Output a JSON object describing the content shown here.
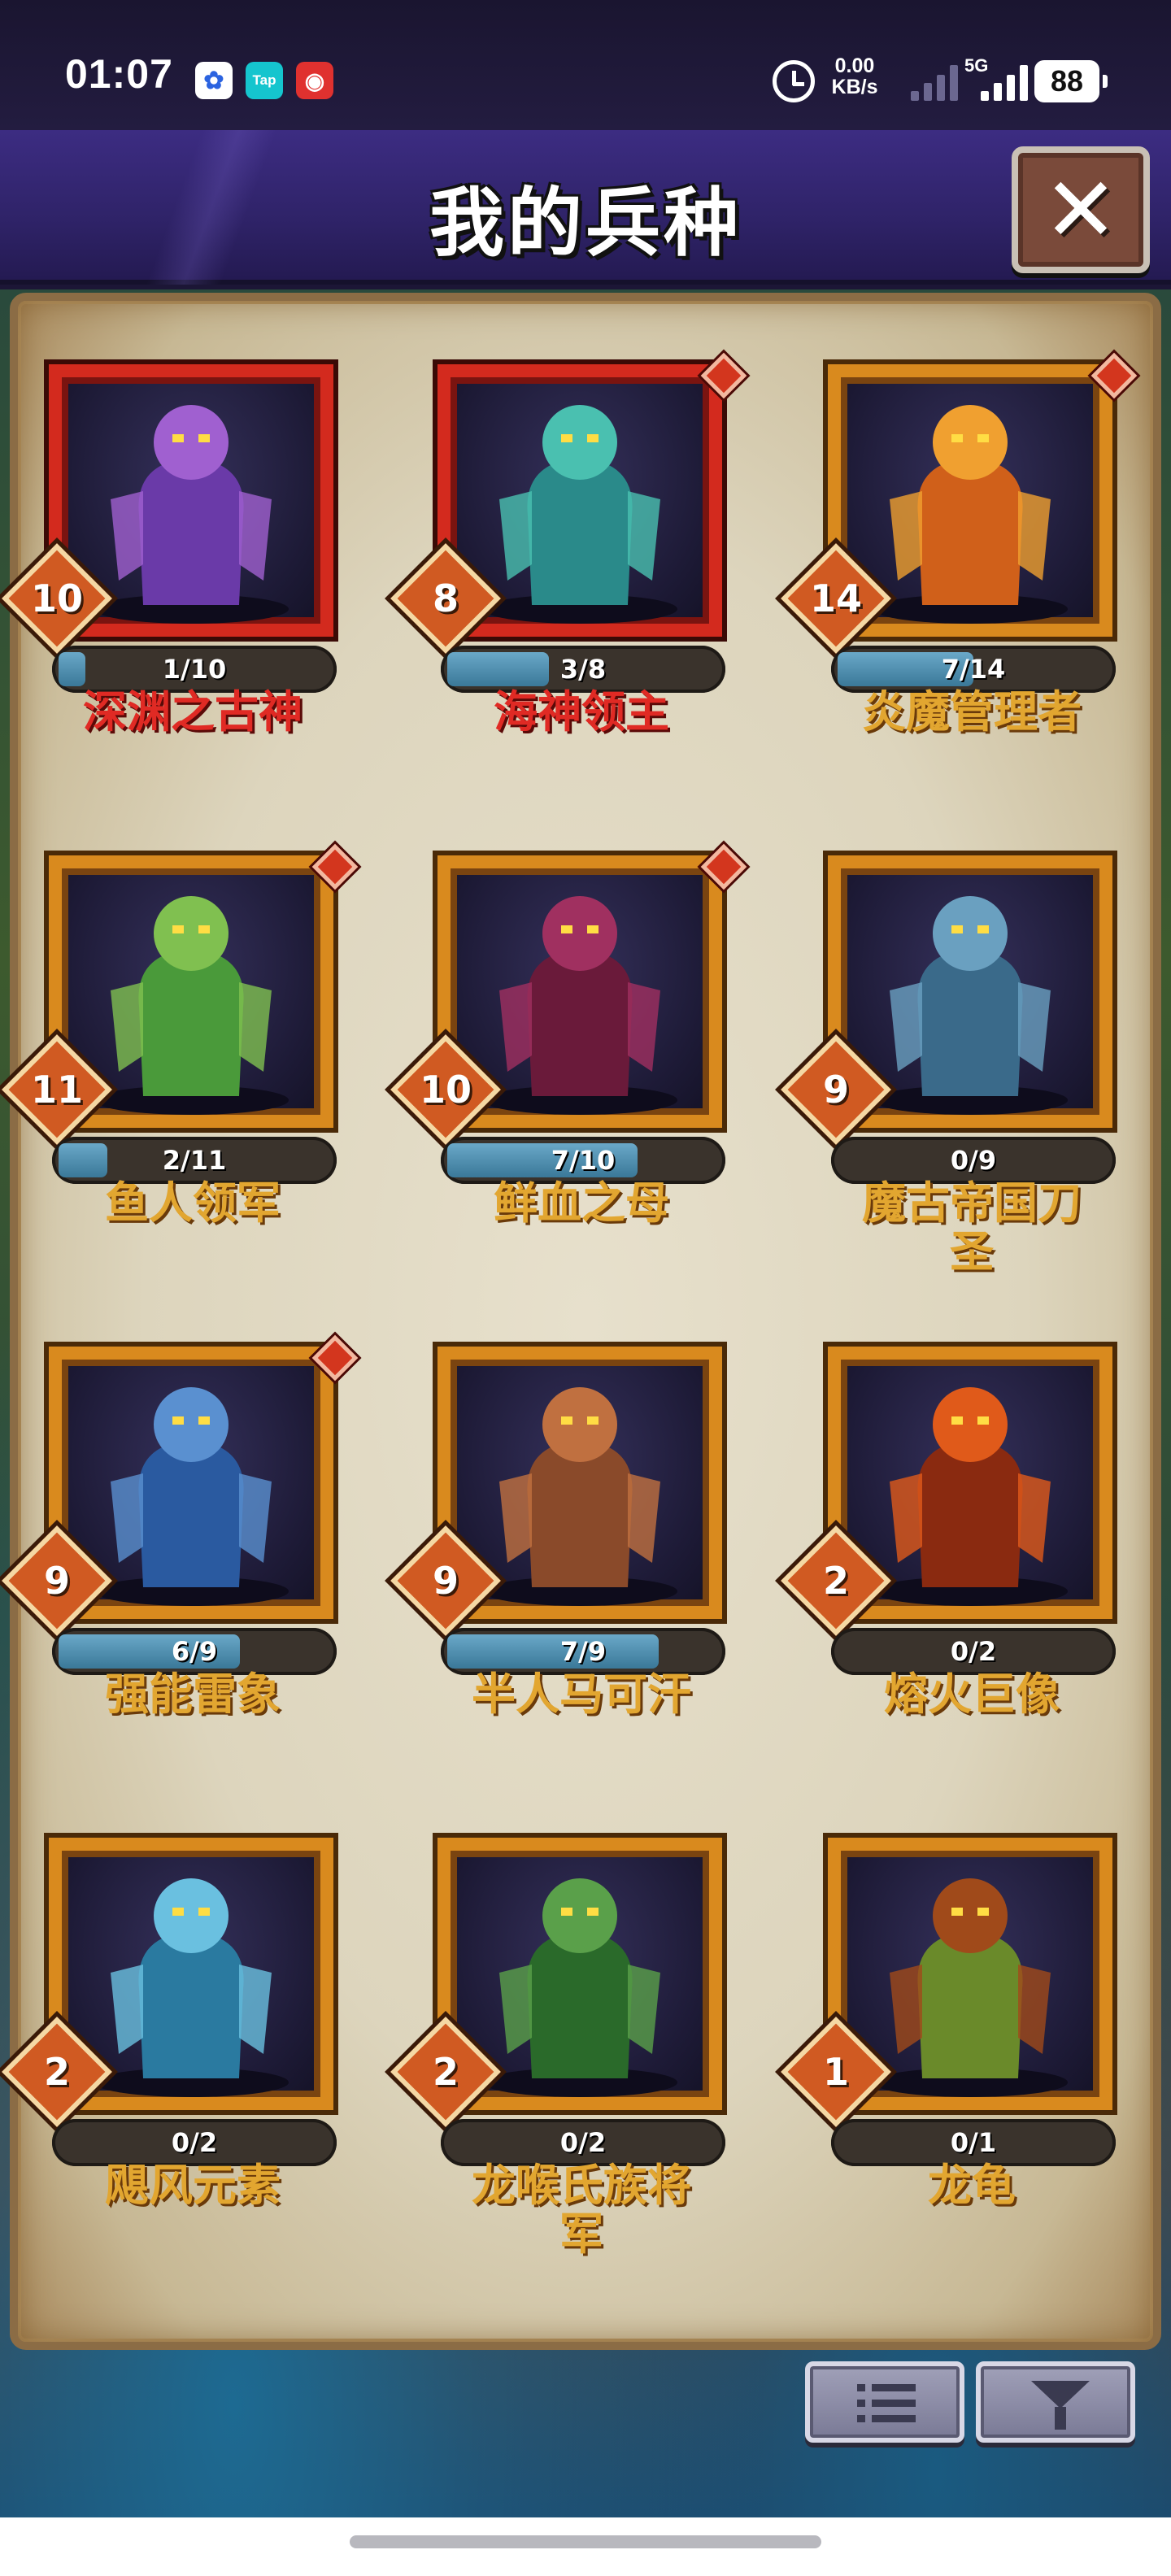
{
  "status_bar": {
    "time": "01:07",
    "apps": [
      {
        "name": "baidu-icon",
        "glyph": "✿"
      },
      {
        "name": "taptap-icon",
        "glyph": "Tap"
      },
      {
        "name": "netease-music-icon",
        "glyph": "◉"
      }
    ],
    "net_speed_value": "0.00",
    "net_speed_unit": "KB/s",
    "network": "5G",
    "battery": "88"
  },
  "header": {
    "title": "我的兵种",
    "close_glyph": "✕"
  },
  "units": [
    {
      "name": "深渊之古神",
      "level": "10",
      "progress_text": "1/10",
      "progress": 0.1,
      "frame": "red",
      "name_color": "red",
      "new": false
    },
    {
      "name": "海神领主",
      "level": "8",
      "progress_text": "3/8",
      "progress": 0.375,
      "frame": "red",
      "name_color": "red",
      "new": true
    },
    {
      "name": "炎魔管理者",
      "level": "14",
      "progress_text": "7/14",
      "progress": 0.5,
      "frame": "gold",
      "name_color": "gold",
      "new": true
    },
    {
      "name": "鱼人领军",
      "level": "11",
      "progress_text": "2/11",
      "progress": 0.18,
      "frame": "gold",
      "name_color": "gold",
      "new": true
    },
    {
      "name": "鲜血之母",
      "level": "10",
      "progress_text": "7/10",
      "progress": 0.7,
      "frame": "gold",
      "name_color": "gold",
      "new": true
    },
    {
      "name": "魔古帝国刀圣",
      "level": "9",
      "progress_text": "0/9",
      "progress": 0,
      "frame": "gold",
      "name_color": "gold",
      "new": false
    },
    {
      "name": "强能雷象",
      "level": "9",
      "progress_text": "6/9",
      "progress": 0.667,
      "frame": "gold",
      "name_color": "gold",
      "new": true
    },
    {
      "name": "半人马可汗",
      "level": "9",
      "progress_text": "7/9",
      "progress": 0.778,
      "frame": "gold",
      "name_color": "gold",
      "new": false
    },
    {
      "name": "熔火巨像",
      "level": "2",
      "progress_text": "0/2",
      "progress": 0,
      "frame": "gold",
      "name_color": "gold",
      "new": false
    },
    {
      "name": "飓风元素",
      "level": "2",
      "progress_text": "0/2",
      "progress": 0,
      "frame": "gold",
      "name_color": "gold",
      "new": false
    },
    {
      "name": "龙喉氏族将军",
      "level": "2",
      "progress_text": "0/2",
      "progress": 0,
      "frame": "gold",
      "name_color": "gold",
      "new": false
    },
    {
      "name": "龙龟",
      "level": "1",
      "progress_text": "0/1",
      "progress": 0,
      "frame": "gold",
      "name_color": "gold",
      "new": false
    }
  ],
  "toolbar": {
    "list_button_icon": "list-icon",
    "filter_button_icon": "filter-icon"
  }
}
